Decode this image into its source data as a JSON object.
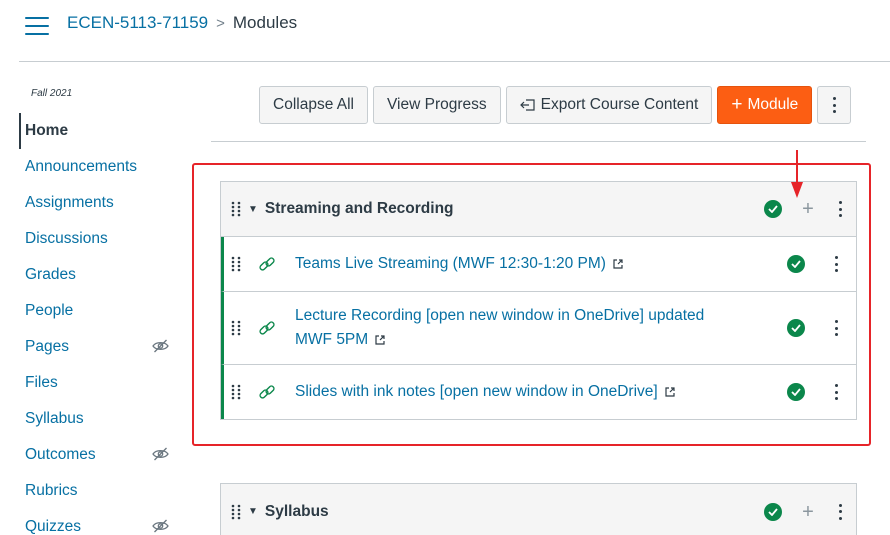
{
  "breadcrumb": {
    "course": "ECEN-5113-71159",
    "separator": ">",
    "current": "Modules"
  },
  "sidebar": {
    "term": "Fall 2021",
    "items": [
      {
        "label": "Home",
        "active": true,
        "hidden": false
      },
      {
        "label": "Announcements",
        "active": false,
        "hidden": false
      },
      {
        "label": "Assignments",
        "active": false,
        "hidden": false
      },
      {
        "label": "Discussions",
        "active": false,
        "hidden": false
      },
      {
        "label": "Grades",
        "active": false,
        "hidden": false
      },
      {
        "label": "People",
        "active": false,
        "hidden": false
      },
      {
        "label": "Pages",
        "active": false,
        "hidden": true
      },
      {
        "label": "Files",
        "active": false,
        "hidden": false
      },
      {
        "label": "Syllabus",
        "active": false,
        "hidden": false
      },
      {
        "label": "Outcomes",
        "active": false,
        "hidden": true
      },
      {
        "label": "Rubrics",
        "active": false,
        "hidden": false
      },
      {
        "label": "Quizzes",
        "active": false,
        "hidden": true
      }
    ]
  },
  "toolbar": {
    "collapse_all": "Collapse All",
    "view_progress": "View Progress",
    "export": "Export Course Content",
    "add_module": "Module",
    "add_module_prefix": "+"
  },
  "modules": [
    {
      "title": "Streaming and Recording",
      "published": true,
      "items": [
        {
          "title": "Teams Live Streaming (MWF 12:30-1:20 PM)",
          "type": "external-link",
          "published": true
        },
        {
          "title": "Lecture Recording [open new window in OneDrive] updated MWF 5PM",
          "type": "external-link",
          "published": true
        },
        {
          "title": "Slides with ink notes [open new window in OneDrive]",
          "type": "external-link",
          "published": true
        }
      ]
    },
    {
      "title": "Syllabus",
      "published": true,
      "items": []
    }
  ],
  "colors": {
    "link": "#0770a3",
    "text": "#2d3b45",
    "published": "#0b874b",
    "primary_button": "#fc5e13",
    "highlight": "#e62429"
  },
  "icons": {
    "menu": "hamburger-icon",
    "drag": "drag-handle-icon",
    "link": "link-icon",
    "external": "external-link-icon",
    "published": "published-check-icon",
    "add": "plus-icon",
    "more": "kebab-icon",
    "hidden": "eye-slash-icon"
  }
}
